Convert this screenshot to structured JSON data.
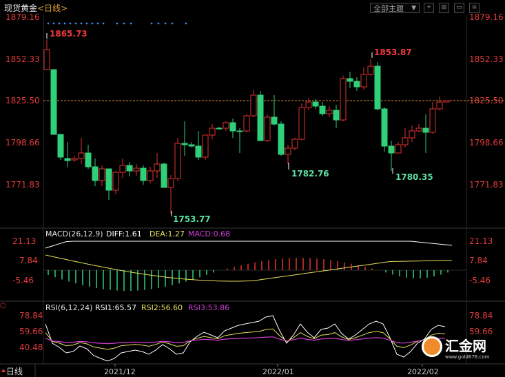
{
  "header": {
    "title": "现货黄金",
    "period": "<日线>",
    "theme_button": "全部主题",
    "dropdown_icon": "triangle-down-icon",
    "toolbar_icons": [
      "crosshair-icon",
      "grid-icon",
      "maximize-icon",
      "menu-icon"
    ]
  },
  "colors": {
    "up": "#e0342f",
    "down": "#2fd07a",
    "price_label_up": "#f03a3a",
    "price_label_down": "#5de0a0",
    "axis_text": "#e03a3a",
    "white_line": "#ffffff",
    "yellow_line": "#e8e05a",
    "magenta_line": "#d23cd6",
    "current_line": "#e08a3a",
    "dots": "#3a8ae8"
  },
  "price_axis": [
    "1879.16",
    "1852.33",
    "1825.50",
    "1798.66",
    "1771.83"
  ],
  "annotations": {
    "high": "1865.73",
    "low": "1753.77",
    "mark1": "1782.76",
    "mark2": "1853.87",
    "mark3": "1780.35"
  },
  "macd": {
    "label": "MACD(26,12,9)",
    "diff": "DIFF:1.61",
    "dea": "DEA:1.27",
    "macd": "MACD:0.68",
    "axis": [
      "21.13",
      "7.84",
      "-5.46"
    ]
  },
  "rsi": {
    "label": "RSI(6,12,24)",
    "rsi1": "RSI1:65.57",
    "rsi2": "RSI2:56.60",
    "rsi3": "RSI3:53.86",
    "axis": [
      "78.84",
      "59.66",
      "40.48"
    ]
  },
  "footer": {
    "period_tab": "日线",
    "tab_icon": "triangle-up-icon",
    "dates": [
      "2021/12",
      "2022/01",
      "2022/02"
    ]
  },
  "logo": {
    "text": "汇金网",
    "url": "www.gold678.com"
  }
}
